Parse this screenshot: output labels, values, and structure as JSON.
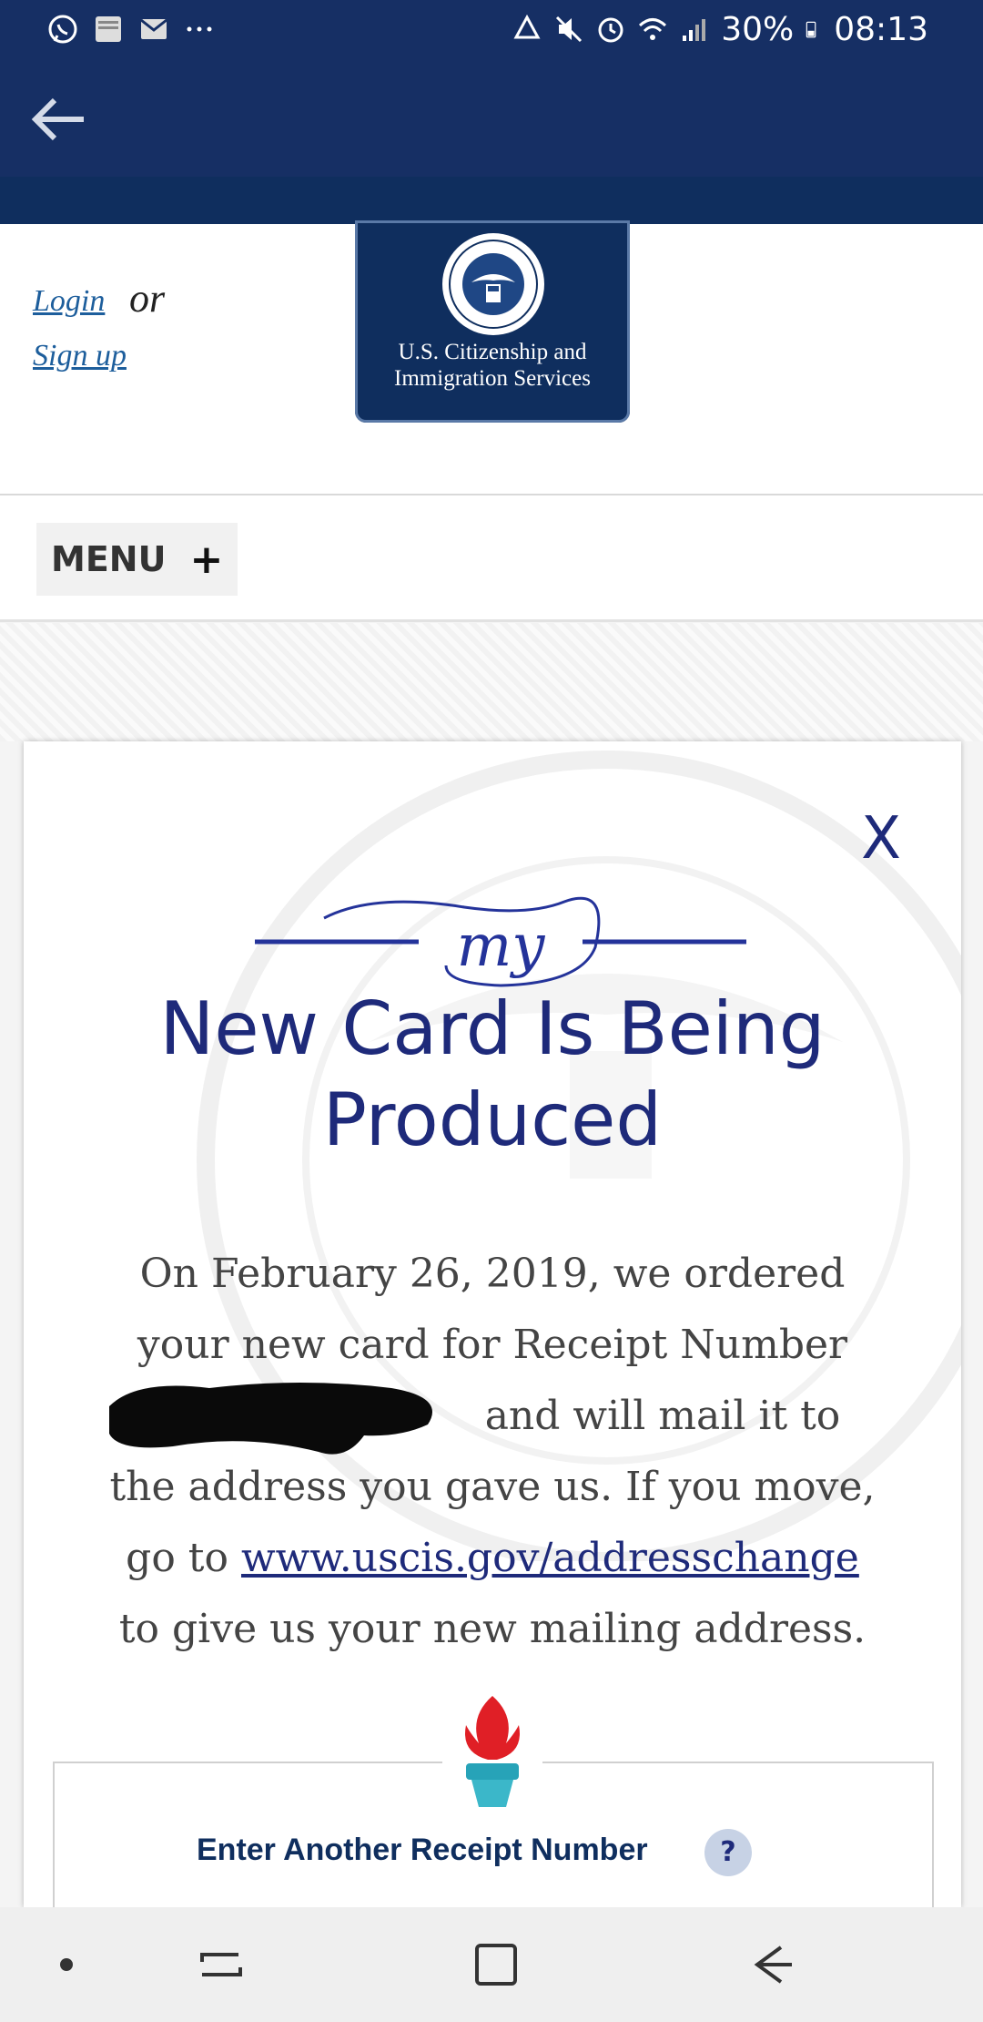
{
  "status_bar": {
    "battery": "30%",
    "time": "08:13",
    "icons": [
      "whatsapp-icon",
      "bible-app-icon",
      "mail-icon",
      "more-icon",
      "recycle-icon",
      "mute-icon",
      "alarm-icon",
      "wifi-icon",
      "signal-icon",
      "battery-icon"
    ]
  },
  "app_bar": {
    "back_icon": "arrow-left-icon"
  },
  "header": {
    "login": "Login",
    "or": "or",
    "signup": "Sign up",
    "logo_line1": "U.S. Citizenship and",
    "logo_line2": "Immigration Services"
  },
  "menu": {
    "label": "MENU",
    "plus": "+"
  },
  "modal": {
    "close": "X",
    "my_logo_text": "my",
    "title_line1": "New Card Is Being",
    "title_line2": "Produced",
    "body": {
      "part1": "On February 26, 2019, we ordered your new card for Receipt Number",
      "part2": "and will mail it to the address you gave us. If you move, go to",
      "link": "www.uscis.gov/addresschange",
      "part3": "to give us your new mailing address."
    },
    "receipt_label": "Enter Another Receipt Number",
    "help": "?"
  },
  "nav_bar": {
    "buttons": [
      "dot-icon",
      "recent-apps-icon",
      "home-icon",
      "back-icon"
    ]
  },
  "colors": {
    "primary_navy": "#162f64",
    "title_blue": "#1e2a7a",
    "link_blue": "#1d5e9c"
  }
}
